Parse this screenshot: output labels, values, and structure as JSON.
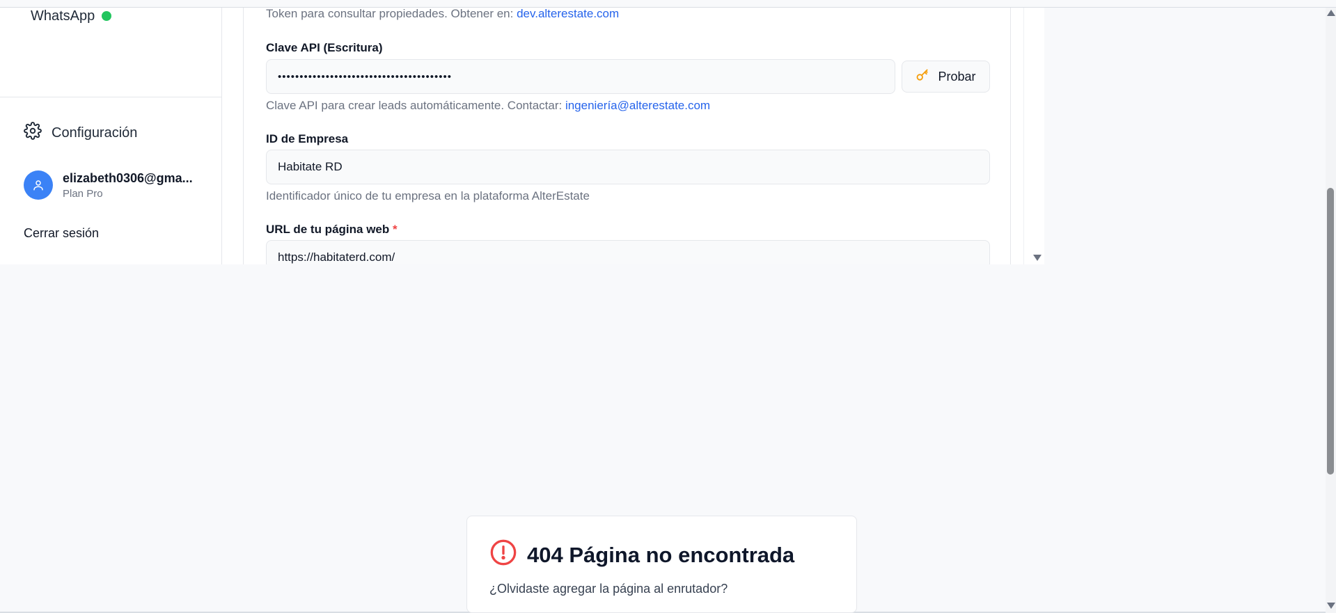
{
  "sidebar": {
    "whatsapp_label": "WhatsApp",
    "whatsapp_status_color": "#22c55e",
    "config_label": "Configuración",
    "user": {
      "email": "elizabeth0306@gma...",
      "plan": "Plan Pro"
    },
    "logout_label": "Cerrar sesión"
  },
  "form": {
    "token_help_text": "Token para consultar propiedades. Obtener en:",
    "token_help_link": "dev.alterestate.com",
    "api_key": {
      "label": "Clave API (Escritura)",
      "value": "••••••••••••••••••••••••••••••••••••••••",
      "test_button_label": "Probar",
      "help_text": "Clave API para crear leads automáticamente. Contactar:",
      "help_link": "ingeniería@alterestate.com"
    },
    "company_id": {
      "label": "ID de Empresa",
      "value": "Habitate RD",
      "help_text": "Identificador único de tu empresa en la plataforma AlterEstate"
    },
    "website_url": {
      "label": "URL de tu página web",
      "required_mark": "*",
      "value": "https://habitaterd.com/"
    }
  },
  "not_found": {
    "title": "404 Página no encontrada",
    "subtitle": "¿Olvidaste agregar la página al enrutador?",
    "icon_color": "#ef4444"
  },
  "colors": {
    "accent": "#3b82f6",
    "link": "#2563eb"
  }
}
